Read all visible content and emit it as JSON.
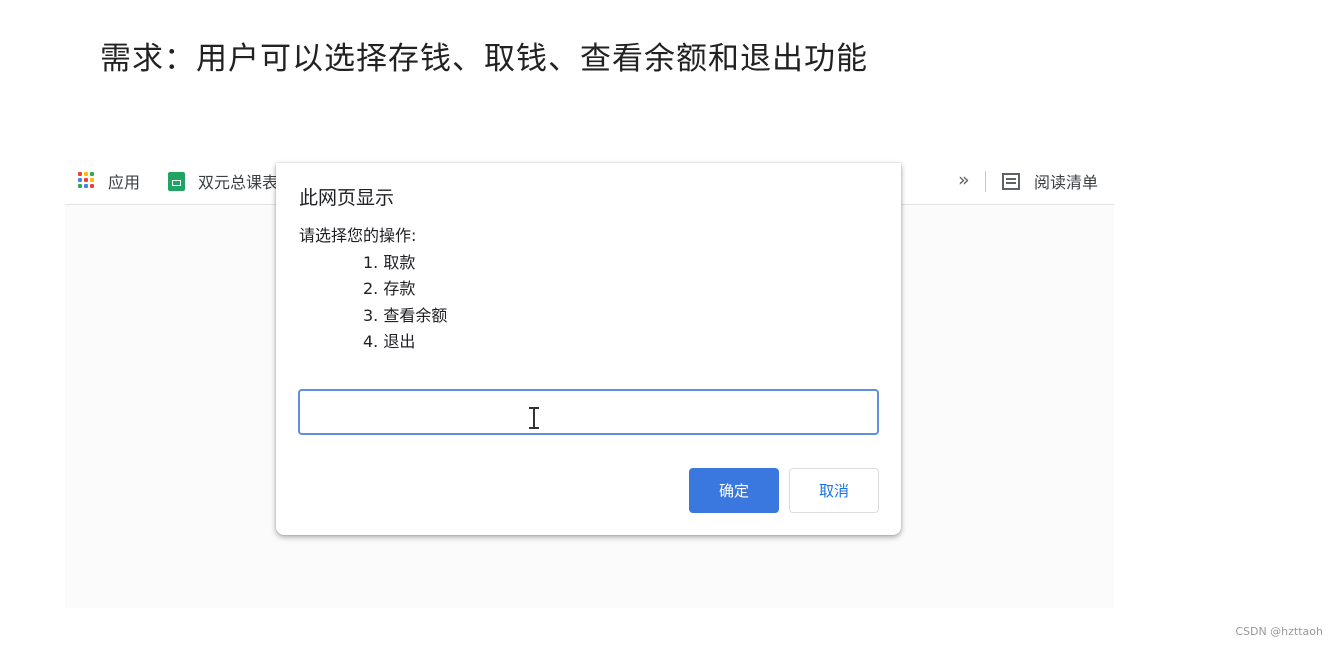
{
  "heading": "需求：用户可以选择存钱、取钱、查看余额和退出功能",
  "bookmarks": {
    "apps_label": "应用",
    "sheet_label": "双元总课表",
    "chevrons": "»",
    "reading_list_label": "阅读清单",
    "apps_icon_colors": [
      "#ea4335",
      "#fbbc04",
      "#34a853",
      "#4285f4",
      "#ea4335",
      "#fbbc04",
      "#34a853",
      "#4285f4",
      "#ea4335"
    ]
  },
  "dialog": {
    "title": "此网页显示",
    "message": "请选择您的操作:",
    "options": [
      "1. 取款",
      "2. 存款",
      "3. 查看余额",
      "4. 退出"
    ],
    "input_value": "",
    "ok_label": "确定",
    "cancel_label": "取消"
  },
  "watermark": "CSDN @hzttaoh"
}
